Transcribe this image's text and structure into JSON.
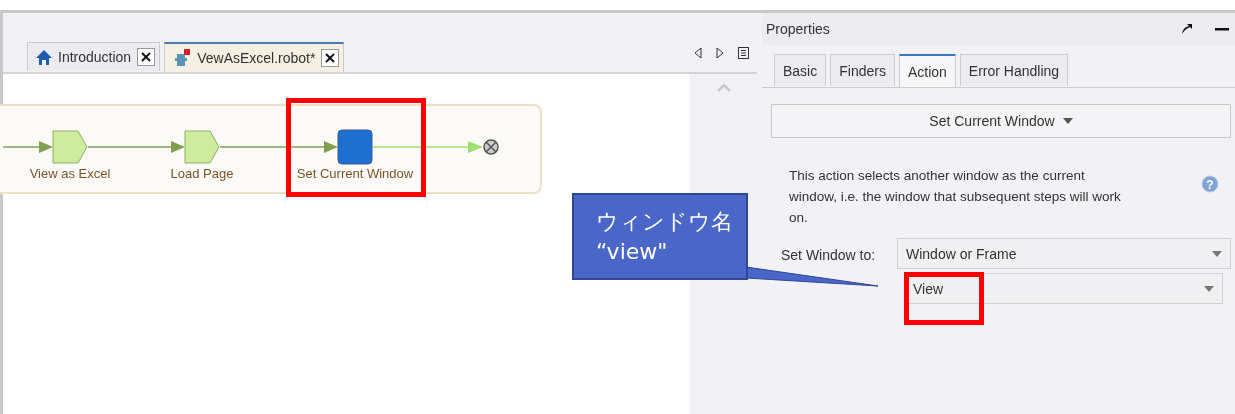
{
  "editor": {
    "tabs": [
      {
        "label": "Introduction",
        "kind": "home",
        "selected": false
      },
      {
        "label": "VewAsExcel.robot*",
        "kind": "robot",
        "selected": true
      }
    ],
    "flow": {
      "steps": [
        {
          "label": "View as Excel",
          "kind": "hexagon"
        },
        {
          "label": "Load Page",
          "kind": "hexagon"
        },
        {
          "label": "Set Current Window",
          "kind": "square"
        }
      ]
    }
  },
  "properties": {
    "title": "Properties",
    "tabs": [
      {
        "label": "Basic",
        "selected": false
      },
      {
        "label": "Finders",
        "selected": false
      },
      {
        "label": "Action",
        "selected": true
      },
      {
        "label": "Error Handling",
        "selected": false
      }
    ],
    "action": "Set Current Window",
    "description": "This action selects another window as the current window, i.e. the window that subsequent steps will work on.",
    "help_icon": "?",
    "set_window_label": "Set Window to:",
    "dropdowns": [
      "Window or Frame",
      "View"
    ]
  },
  "callout": {
    "lines": [
      "ウィンドウ名",
      "“view\""
    ]
  }
}
